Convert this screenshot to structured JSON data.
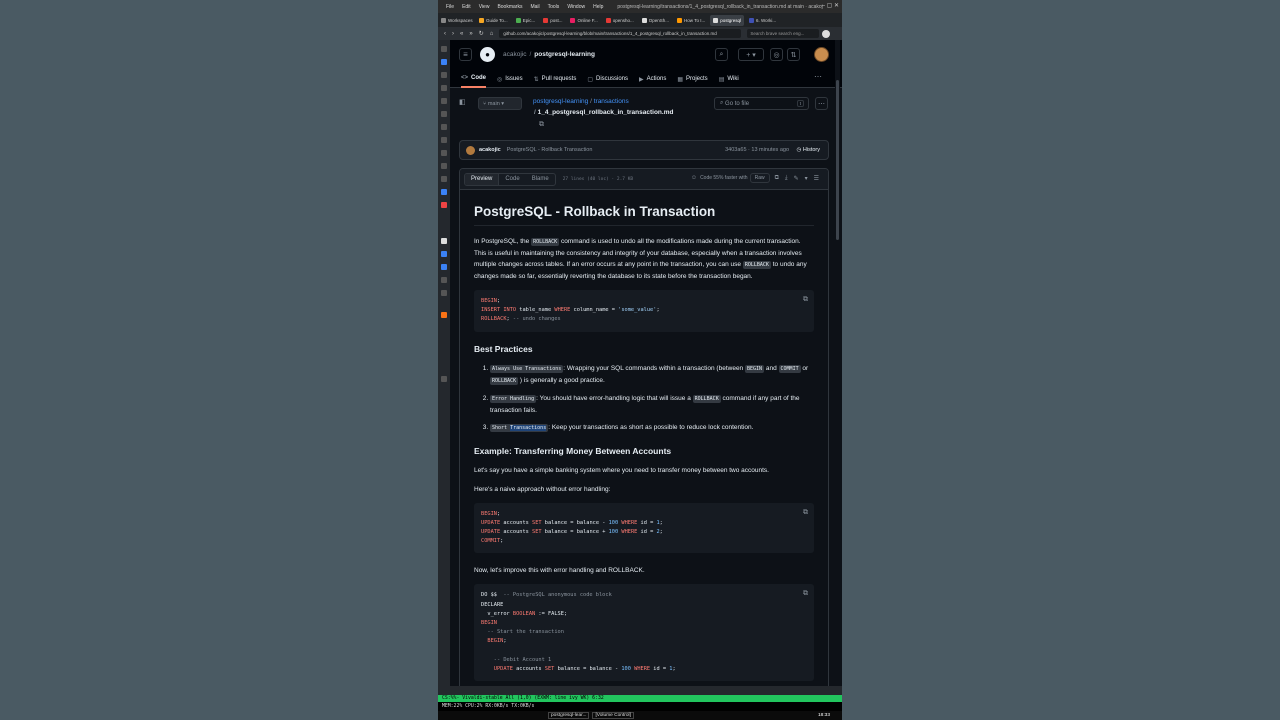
{
  "browser": {
    "menu": [
      "File",
      "Edit",
      "View",
      "Bookmarks",
      "Mail",
      "Tools",
      "Window",
      "Help"
    ],
    "window_title": "postgresql-learning/transactions/1_4_postgresql_rollback_in_transaction.md at main · acakoj",
    "tabs": [
      {
        "label": "Workspaces",
        "color": "#888888"
      },
      {
        "label": "Guide To...",
        "color": "#f5a623"
      },
      {
        "label": "Epic...",
        "color": "#4caf50"
      },
      {
        "label": "post...",
        "color": "#e53935"
      },
      {
        "label": "Online F...",
        "color": "#e91e63"
      },
      {
        "label": "opensho...",
        "color": "#e53935"
      },
      {
        "label": "OpenSh...",
        "color": "#dddddd"
      },
      {
        "label": "How To I...",
        "color": "#ff9800"
      },
      {
        "label": "postgresql",
        "color": "#dddddd"
      },
      {
        "label": "6. Worki...",
        "color": "#3f51b5"
      }
    ],
    "url": "github.com/acakojic/postgresql-learning/blob/main/transactions/1_4_postgresql_rollback_in_transaction.md",
    "search_placeholder": "Search brave search eng..."
  },
  "github": {
    "owner": "acakojic",
    "repo": "postgresql-learning",
    "nav": [
      "Code",
      "Issues",
      "Pull requests",
      "Discussions",
      "Actions",
      "Projects",
      "Wiki"
    ],
    "branch": "main",
    "breadcrumb_repo": "postgresql-learning",
    "breadcrumb_dir": "transactions",
    "filename": "1_4_postgresql_rollback_in_transaction.md",
    "goto_file": "Go to file",
    "goto_kbd": "t",
    "commit": {
      "user": "acakojic",
      "message": "PostgreSQL - Rollback Transaction",
      "hash": "3403a65",
      "time": "13 minutes ago",
      "history": "History"
    },
    "file_tabs": [
      "Preview",
      "Code",
      "Blame"
    ],
    "file_meta": "27 lines (40 loc) · 2.7 KB",
    "code_faster": "Code 55% faster with",
    "raw": "Raw"
  },
  "doc": {
    "title": "PostgreSQL - Rollback in Transaction",
    "intro_a": "In PostgreSQL, the",
    "intro_code": "ROLLBACK",
    "intro_b": "command is used to undo all the modifications made during the current transaction. This is useful in maintaining the consistency and integrity of your database, especially when a transaction involves multiple changes across tables. If an error occurs at any point in the transaction, you can use",
    "intro_code2": "ROLLBACK",
    "intro_c": "to undo any changes made so far, essentially reverting the database to its state before the transaction began.",
    "best_heading": "Best Practices",
    "bp1_code": "Always Use Transactions",
    "bp1_text": ": Wrapping your SQL commands within a transaction (between",
    "bp1_c2": "BEGIN",
    "bp1_and": "and",
    "bp1_c3": "COMMIT",
    "bp1_or": "or",
    "bp1_c4": "ROLLBACK",
    "bp1_end": ") is generally a good practice.",
    "bp2_code": "Error Handling",
    "bp2_text": ": You should have error-handling logic that will issue a",
    "bp2_c2": "ROLLBACK",
    "bp2_end": "command if any part of the transaction fails.",
    "bp3_code_a": "Short",
    "bp3_code_b": "Transactions",
    "bp3_text": ": Keep your transactions as short as possible to reduce lock contention.",
    "example_heading": "Example: Transferring Money Between Accounts",
    "ex_p1": "Let's say you have a simple banking system where you need to transfer money between two accounts.",
    "ex_p2": "Here's a naive approach without error handling:",
    "ex_p3": "Now, let's improve this with error handling and ROLLBACK."
  },
  "status": {
    "vim": "CS:%%-  Vivaldi-stable   All (1,0)      (EXWM: line ivy WK) 6:32",
    "sys": "MEM:22%         CPU:2%         RX:0KB/s         TX:0KB/s",
    "task_active": "postgresql-lear...",
    "task_vol": "[Volume Control]",
    "clock": "18:33"
  }
}
